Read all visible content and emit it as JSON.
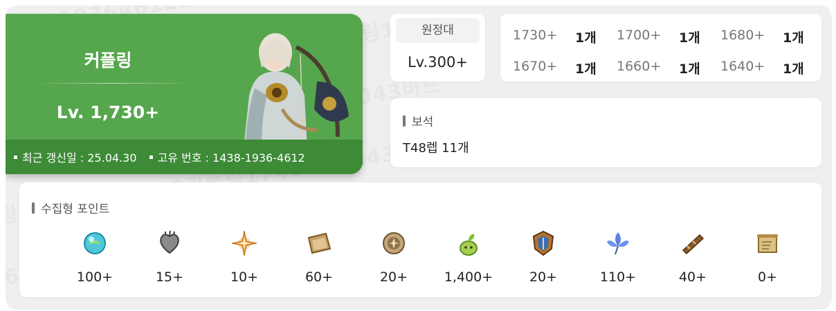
{
  "watermark": [
    "250430바드14381936461225043바드1438193646",
    "커플링1740+250430커플링1740+250430커플링1740+",
    "4381936461225043바드14381936461225043바드",
    "250430커플링1740+250430커플링1740+25043",
    "1438193646122504바드143819364612250430"
  ],
  "character": {
    "name": "커플링",
    "level": "Lv. 1,730+",
    "updated": "최근 갱신일 : 25.04.30",
    "id": "고유 번호 : 1438-1936-4612",
    "theme_color": "#56a64d"
  },
  "expedition": {
    "label": "원정대",
    "value": "Lv.300+"
  },
  "roster": [
    {
      "level": "1730+",
      "count": "1개"
    },
    {
      "level": "1700+",
      "count": "1개"
    },
    {
      "level": "1680+",
      "count": "1개"
    },
    {
      "level": "1670+",
      "count": "1개"
    },
    {
      "level": "1660+",
      "count": "1개"
    },
    {
      "level": "1640+",
      "count": "1개"
    }
  ],
  "gems": {
    "title": "보석",
    "value": "T48렙 11개"
  },
  "collection": {
    "title": "수집형 포인트",
    "items": [
      {
        "icon": "island-heart-orb-icon",
        "value": "100+"
      },
      {
        "icon": "giant-heart-icon",
        "value": "15+"
      },
      {
        "icon": "star-compass-icon",
        "value": "10+"
      },
      {
        "icon": "art-canvas-icon",
        "value": "60+"
      },
      {
        "icon": "voyage-medal-icon",
        "value": "20+"
      },
      {
        "icon": "mokoko-seed-icon",
        "value": "1,400+"
      },
      {
        "icon": "world-tree-crest-icon",
        "value": "20+"
      },
      {
        "icon": "world-tree-leaf-icon",
        "value": "110+"
      },
      {
        "icon": "spyglass-icon",
        "value": "40+"
      },
      {
        "icon": "scroll-map-icon",
        "value": "0+"
      }
    ]
  }
}
